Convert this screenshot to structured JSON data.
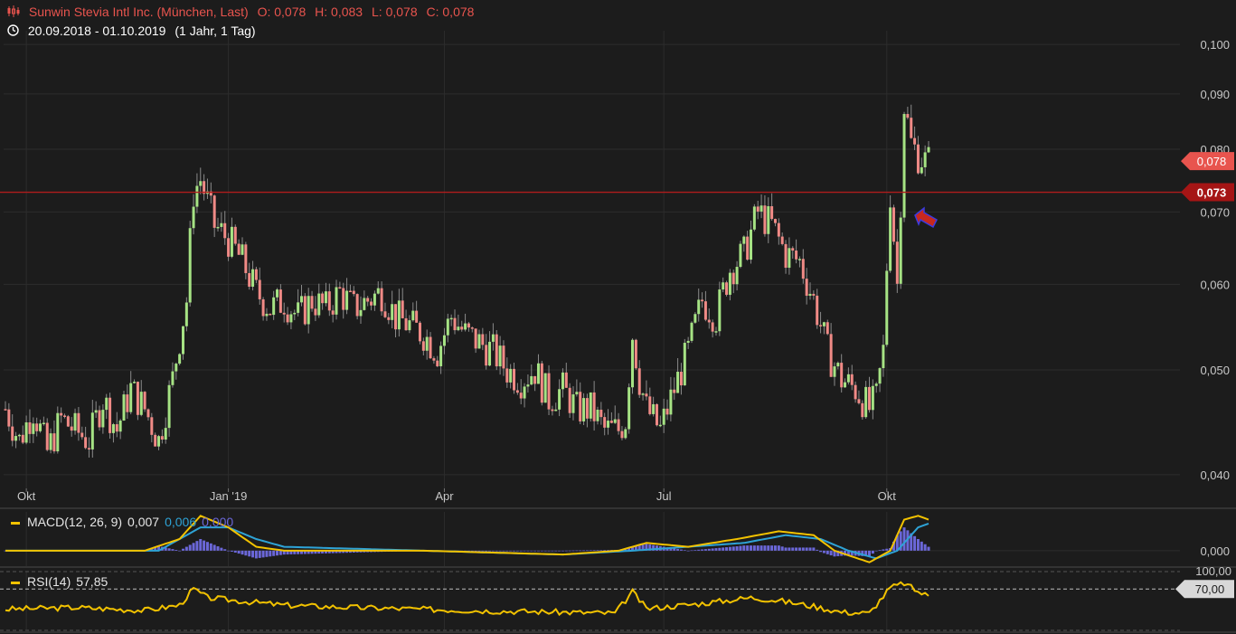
{
  "header": {
    "instrument": "Sunwin Stevia Intl Inc. (München, Last)",
    "open": "O: 0,078",
    "high": "H: 0,083",
    "low": "L: 0,078",
    "close": "C: 0,078",
    "range": "20.09.2018 - 01.10.2019",
    "period": "(1 Jahr, 1 Tag)",
    "chart_icon": "candlestick-icon",
    "clock_icon": "clock-icon"
  },
  "indicators": {
    "macd": {
      "label": "MACD(12, 26, 9)",
      "v1": "0,007",
      "v2": "0,006",
      "v3": "0,000"
    },
    "rsi": {
      "label": "RSI(14)",
      "value": "57,85"
    }
  },
  "colors": {
    "bg": "#1c1c1c",
    "up": "#a6e384",
    "down": "#f08a86",
    "wick": "#8a8a8a",
    "line": "#b01c1c",
    "macd": "#f2c200",
    "signal": "#2ea3d6",
    "hist": "#6b67d8",
    "rsi": "#f2c200",
    "arrow": "#c8281e",
    "arrow_outline": "#3b3be0"
  },
  "chart_data": [
    {
      "type": "candlestick",
      "x_ticks": [
        "Okt",
        "Jan '19",
        "Apr",
        "Jul",
        "Okt"
      ],
      "y_ticks": [
        "0,100",
        "0,090",
        "0,080",
        "0,070",
        "0,060",
        "0,050",
        "0,040"
      ],
      "ylim": [
        0.039,
        0.101
      ],
      "y_scale": "log",
      "price_labels": [
        {
          "text": "0,078",
          "value": 0.078,
          "style": "last"
        },
        {
          "text": "0,073",
          "value": 0.073,
          "style": "line"
        }
      ],
      "horizontal_line": 0.073,
      "annotation": "arrow",
      "grid": true,
      "anchors": [
        [
          0,
          0.046
        ],
        [
          4,
          0.043
        ],
        [
          8,
          0.046
        ],
        [
          12,
          0.042
        ],
        [
          16,
          0.045
        ],
        [
          20,
          0.044
        ],
        [
          24,
          0.043
        ],
        [
          28,
          0.047
        ],
        [
          32,
          0.044
        ],
        [
          36,
          0.048
        ],
        [
          40,
          0.046
        ],
        [
          44,
          0.043
        ],
        [
          48,
          0.049
        ],
        [
          52,
          0.058
        ],
        [
          54,
          0.073
        ],
        [
          56,
          0.075
        ],
        [
          60,
          0.068
        ],
        [
          64,
          0.066
        ],
        [
          68,
          0.063
        ],
        [
          72,
          0.059
        ],
        [
          76,
          0.057
        ],
        [
          80,
          0.058
        ],
        [
          84,
          0.056
        ],
        [
          88,
          0.058
        ],
        [
          92,
          0.057
        ],
        [
          96,
          0.059
        ],
        [
          100,
          0.057
        ],
        [
          104,
          0.058
        ],
        [
          108,
          0.059
        ],
        [
          112,
          0.056
        ],
        [
          116,
          0.055
        ],
        [
          120,
          0.054
        ],
        [
          124,
          0.052
        ],
        [
          128,
          0.056
        ],
        [
          132,
          0.054
        ],
        [
          136,
          0.053
        ],
        [
          140,
          0.052
        ],
        [
          144,
          0.05
        ],
        [
          148,
          0.049
        ],
        [
          152,
          0.05
        ],
        [
          156,
          0.047
        ],
        [
          160,
          0.048
        ],
        [
          164,
          0.046
        ],
        [
          168,
          0.046
        ],
        [
          172,
          0.044
        ],
        [
          176,
          0.044
        ],
        [
          178,
          0.045
        ],
        [
          180,
          0.054
        ],
        [
          182,
          0.049
        ],
        [
          184,
          0.046
        ],
        [
          188,
          0.044
        ],
        [
          192,
          0.048
        ],
        [
          196,
          0.052
        ],
        [
          200,
          0.058
        ],
        [
          204,
          0.056
        ],
        [
          208,
          0.062
        ],
        [
          212,
          0.064
        ],
        [
          216,
          0.07
        ],
        [
          220,
          0.068
        ],
        [
          224,
          0.064
        ],
        [
          228,
          0.063
        ],
        [
          232,
          0.058
        ],
        [
          236,
          0.052
        ],
        [
          240,
          0.049
        ],
        [
          244,
          0.048
        ],
        [
          248,
          0.046
        ],
        [
          250,
          0.047
        ],
        [
          252,
          0.052
        ],
        [
          254,
          0.073
        ],
        [
          256,
          0.06
        ],
        [
          257,
          0.072
        ],
        [
          258,
          0.088
        ],
        [
          260,
          0.081
        ],
        [
          262,
          0.079
        ],
        [
          264,
          0.078
        ],
        [
          265,
          0.078
        ]
      ]
    },
    {
      "type": "line",
      "name": "MACD(12, 26, 9)",
      "series": [
        {
          "name": "MACD",
          "anchors": [
            [
              0,
              0.0
            ],
            [
              40,
              0.0
            ],
            [
              50,
              0.003
            ],
            [
              56,
              0.009
            ],
            [
              64,
              0.006
            ],
            [
              72,
              0.001
            ],
            [
              80,
              0.0
            ],
            [
              120,
              0.0
            ],
            [
              160,
              -0.001
            ],
            [
              176,
              0.0
            ],
            [
              184,
              0.002
            ],
            [
              196,
              0.001
            ],
            [
              210,
              0.003
            ],
            [
              222,
              0.005
            ],
            [
              232,
              0.004
            ],
            [
              238,
              0.0
            ],
            [
              248,
              -0.003
            ],
            [
              254,
              0.0
            ],
            [
              258,
              0.008
            ],
            [
              262,
              0.009
            ],
            [
              265,
              0.008
            ]
          ]
        },
        {
          "name": "Signal",
          "anchors": [
            [
              0,
              0.0
            ],
            [
              44,
              0.0
            ],
            [
              56,
              0.006
            ],
            [
              64,
              0.006
            ],
            [
              72,
              0.003
            ],
            [
              80,
              0.001
            ],
            [
              120,
              0.0
            ],
            [
              160,
              -0.001
            ],
            [
              180,
              0.0
            ],
            [
              196,
              0.001
            ],
            [
              212,
              0.002
            ],
            [
              224,
              0.004
            ],
            [
              234,
              0.003
            ],
            [
              242,
              0.0
            ],
            [
              250,
              -0.002
            ],
            [
              256,
              0.0
            ],
            [
              262,
              0.006
            ],
            [
              265,
              0.007
            ]
          ]
        }
      ],
      "y_ticks": [
        "0,000"
      ],
      "ylim": [
        -0.004,
        0.01
      ]
    },
    {
      "type": "line",
      "name": "RSI(14)",
      "y_ticks": [
        "100,00",
        "70,00"
      ],
      "ylim": [
        0,
        100
      ],
      "overbought": 70,
      "anchors": [
        [
          0,
          35
        ],
        [
          20,
          38
        ],
        [
          40,
          33
        ],
        [
          50,
          42
        ],
        [
          54,
          70
        ],
        [
          58,
          55
        ],
        [
          66,
          50
        ],
        [
          80,
          42
        ],
        [
          100,
          38
        ],
        [
          120,
          35
        ],
        [
          140,
          32
        ],
        [
          160,
          30
        ],
        [
          175,
          28
        ],
        [
          180,
          65
        ],
        [
          184,
          36
        ],
        [
          200,
          45
        ],
        [
          214,
          55
        ],
        [
          222,
          50
        ],
        [
          232,
          40
        ],
        [
          240,
          30
        ],
        [
          248,
          28
        ],
        [
          254,
          72
        ],
        [
          258,
          80
        ],
        [
          262,
          65
        ],
        [
          265,
          58
        ]
      ]
    }
  ]
}
